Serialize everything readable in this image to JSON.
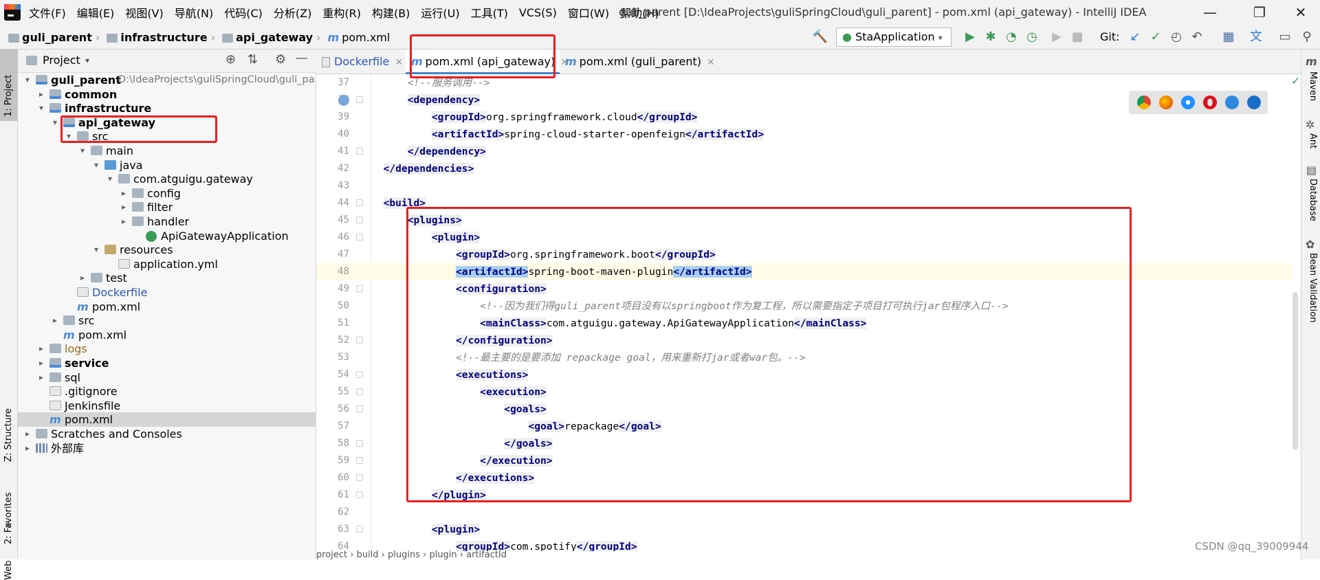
{
  "menubar": {
    "items": [
      "文件(F)",
      "编辑(E)",
      "视图(V)",
      "导航(N)",
      "代码(C)",
      "分析(Z)",
      "重构(R)",
      "构建(B)",
      "运行(U)",
      "工具(T)",
      "VCS(S)",
      "窗口(W)",
      "帮助(H)"
    ],
    "title": "guli_parent [D:\\IdeaProjects\\guliSpringCloud\\guli_parent] - pom.xml (api_gateway) - IntelliJ IDEA",
    "minimize": "—",
    "maximize": "❐",
    "close": "✕"
  },
  "breadcrumb": {
    "items": [
      "guli_parent",
      "infrastructure",
      "api_gateway"
    ],
    "file_icon": "m",
    "file": "pom.xml"
  },
  "toolbar": {
    "run_config": "StaApplication",
    "git_label": "Git:"
  },
  "left_strip": {
    "project": "1: Project",
    "structure": "Z: Structure",
    "favorites": "2: Favorites",
    "web": "Web"
  },
  "right_strip": {
    "maven": "Maven",
    "ant": "Ant",
    "database": "Database",
    "bean": "Bean Validation"
  },
  "project": {
    "title": "Project",
    "tree": [
      {
        "label": "guli_parent",
        "extra": "D:\\IdeaProjects\\guliSpringCloud\\guli_pa",
        "depth": 0,
        "arrow": "▾",
        "icon": "mod",
        "bold": true
      },
      {
        "label": "common",
        "depth": 1,
        "arrow": "▸",
        "icon": "mod",
        "bold": true
      },
      {
        "label": "infrastructure",
        "depth": 1,
        "arrow": "▾",
        "icon": "mod",
        "bold": true
      },
      {
        "label": "api_gateway",
        "depth": 2,
        "arrow": "▾",
        "icon": "mod",
        "bold": true
      },
      {
        "label": "src",
        "depth": 3,
        "arrow": "▾",
        "icon": "folder"
      },
      {
        "label": "main",
        "depth": 4,
        "arrow": "▾",
        "icon": "folder"
      },
      {
        "label": "java",
        "depth": 5,
        "arrow": "▾",
        "icon": "src"
      },
      {
        "label": "com.atguigu.gateway",
        "depth": 6,
        "arrow": "▾",
        "icon": "folder"
      },
      {
        "label": "config",
        "depth": 7,
        "arrow": "▸",
        "icon": "folder"
      },
      {
        "label": "filter",
        "depth": 7,
        "arrow": "▸",
        "icon": "folder"
      },
      {
        "label": "handler",
        "depth": 7,
        "arrow": "▸",
        "icon": "folder"
      },
      {
        "label": "ApiGatewayApplication",
        "depth": 8,
        "arrow": "",
        "icon": "cls"
      },
      {
        "label": "resources",
        "depth": 5,
        "arrow": "▾",
        "icon": "res"
      },
      {
        "label": "application.yml",
        "depth": 6,
        "arrow": "",
        "icon": "file"
      },
      {
        "label": "test",
        "depth": 4,
        "arrow": "▸",
        "icon": "folder"
      },
      {
        "label": "Dockerfile",
        "depth": 3,
        "arrow": "",
        "icon": "file",
        "color": "#2b57b5"
      },
      {
        "label": "pom.xml",
        "depth": 3,
        "arrow": "",
        "icon": "m"
      },
      {
        "label": "src",
        "depth": 2,
        "arrow": "▸",
        "icon": "folder"
      },
      {
        "label": "pom.xml",
        "depth": 2,
        "arrow": "",
        "icon": "m"
      },
      {
        "label": "logs",
        "depth": 1,
        "arrow": "▸",
        "icon": "folder",
        "color": "#9b6a1f"
      },
      {
        "label": "service",
        "depth": 1,
        "arrow": "▸",
        "icon": "mod",
        "bold": true
      },
      {
        "label": "sql",
        "depth": 1,
        "arrow": "▸",
        "icon": "folder"
      },
      {
        "label": ".gitignore",
        "depth": 1,
        "arrow": "",
        "icon": "file"
      },
      {
        "label": "Jenkinsfile",
        "depth": 1,
        "arrow": "",
        "icon": "file"
      },
      {
        "label": "pom.xml",
        "depth": 1,
        "arrow": "",
        "icon": "m",
        "selected": true
      },
      {
        "label": "Scratches and Consoles",
        "depth": 0,
        "arrow": "▸",
        "icon": "folder"
      },
      {
        "label": "外部库",
        "depth": 0,
        "arrow": "▸",
        "icon": "lib"
      }
    ]
  },
  "tabs": [
    {
      "label": "Dockerfile",
      "icon": "file",
      "active": false
    },
    {
      "label": "pom.xml (api_gateway)",
      "icon": "m",
      "active": true
    },
    {
      "label": "pom.xml (guli_parent)",
      "icon": "m",
      "active": false
    }
  ],
  "code": {
    "current_line": 48,
    "lines": [
      {
        "n": 37,
        "indent": 1,
        "parts": [
          [
            "c",
            "<!--服务调用-->"
          ]
        ]
      },
      {
        "n": 38,
        "indent": 1,
        "parts": [
          [
            "t",
            "<dependency>"
          ]
        ]
      },
      {
        "n": 39,
        "indent": 2,
        "parts": [
          [
            "t",
            "<groupId>"
          ],
          [
            "x",
            "org.springframework.cloud"
          ],
          [
            "t",
            "</groupId>"
          ]
        ]
      },
      {
        "n": 40,
        "indent": 2,
        "parts": [
          [
            "t",
            "<artifactId>"
          ],
          [
            "x",
            "spring-cloud-starter-openfeign"
          ],
          [
            "t",
            "</artifactId>"
          ]
        ]
      },
      {
        "n": 41,
        "indent": 1,
        "parts": [
          [
            "t",
            "</dependency>"
          ]
        ]
      },
      {
        "n": 42,
        "indent": 0,
        "parts": [
          [
            "t",
            "</dependencies>"
          ]
        ]
      },
      {
        "n": 43,
        "indent": 0,
        "parts": []
      },
      {
        "n": 44,
        "indent": 0,
        "parts": [
          [
            "t",
            "<build>"
          ]
        ]
      },
      {
        "n": 45,
        "indent": 1,
        "parts": [
          [
            "t",
            "<plugins>"
          ]
        ]
      },
      {
        "n": 46,
        "indent": 2,
        "parts": [
          [
            "t",
            "<plugin>"
          ]
        ]
      },
      {
        "n": 47,
        "indent": 3,
        "parts": [
          [
            "t",
            "<groupId>"
          ],
          [
            "x",
            "org.springframework.boot"
          ],
          [
            "t",
            "</groupId>"
          ]
        ]
      },
      {
        "n": 48,
        "indent": 3,
        "parts": [
          [
            "h",
            "<artifactId>"
          ],
          [
            "x",
            "spring-boot-maven-plugin"
          ],
          [
            "h",
            "</artifactId>"
          ]
        ]
      },
      {
        "n": 49,
        "indent": 3,
        "parts": [
          [
            "t",
            "<configuration>"
          ]
        ]
      },
      {
        "n": 50,
        "indent": 4,
        "parts": [
          [
            "c",
            "<!--因为我们得guli_parent项目没有以springboot作为复工程，所以需要指定子项目打可执行jar包程序入口-->"
          ]
        ]
      },
      {
        "n": 51,
        "indent": 4,
        "parts": [
          [
            "t",
            "<mainClass>"
          ],
          [
            "x",
            "com.atguigu.gateway.ApiGatewayApplication"
          ],
          [
            "t",
            "</mainClass>"
          ]
        ]
      },
      {
        "n": 52,
        "indent": 3,
        "parts": [
          [
            "t",
            "</configuration>"
          ]
        ]
      },
      {
        "n": 53,
        "indent": 3,
        "parts": [
          [
            "c",
            "<!--最主要的是要添加 repackage goal，用来重新打jar或者war包。-->"
          ]
        ]
      },
      {
        "n": 54,
        "indent": 3,
        "parts": [
          [
            "t",
            "<executions>"
          ]
        ]
      },
      {
        "n": 55,
        "indent": 4,
        "parts": [
          [
            "t",
            "<execution>"
          ]
        ]
      },
      {
        "n": 56,
        "indent": 5,
        "parts": [
          [
            "t",
            "<goals>"
          ]
        ]
      },
      {
        "n": 57,
        "indent": 6,
        "parts": [
          [
            "t",
            "<goal>"
          ],
          [
            "x",
            "repackage"
          ],
          [
            "t",
            "</goal>"
          ]
        ]
      },
      {
        "n": 58,
        "indent": 5,
        "parts": [
          [
            "t",
            "</goals>"
          ]
        ]
      },
      {
        "n": 59,
        "indent": 4,
        "parts": [
          [
            "t",
            "</execution>"
          ]
        ]
      },
      {
        "n": 60,
        "indent": 3,
        "parts": [
          [
            "t",
            "</executions>"
          ]
        ]
      },
      {
        "n": 61,
        "indent": 2,
        "parts": [
          [
            "t",
            "</plugin>"
          ]
        ]
      },
      {
        "n": 62,
        "indent": 0,
        "parts": []
      },
      {
        "n": 63,
        "indent": 2,
        "parts": [
          [
            "t",
            "<plugin>"
          ]
        ]
      },
      {
        "n": 64,
        "indent": 3,
        "parts": [
          [
            "t",
            "<groupId>"
          ],
          [
            "x",
            "com.spotify"
          ],
          [
            "t",
            "</groupId>"
          ]
        ]
      }
    ]
  },
  "code_breadcrumb": "project  ›  build  ›  plugins  ›  plugin  ›  artifactId",
  "watermark": "CSDN @qq_39009944",
  "colors": {
    "accent": "#4083c9",
    "annotation": "#ee1c1c",
    "tag": "#000080",
    "comment": "#808080"
  }
}
